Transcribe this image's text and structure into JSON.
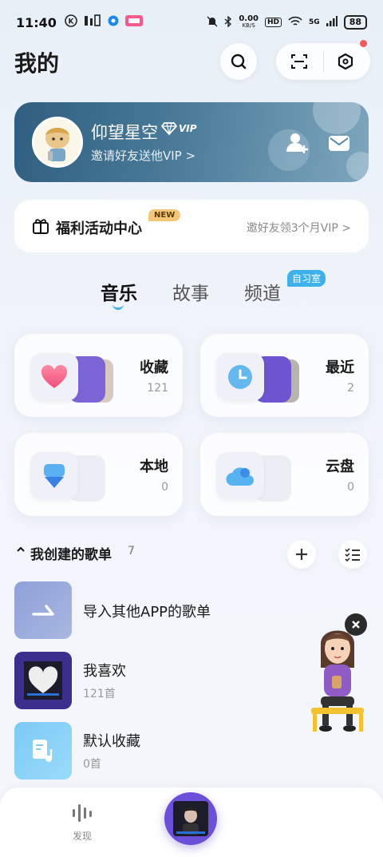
{
  "status_bar": {
    "time": "11:40",
    "net_speed_value": "0.00",
    "net_speed_unit": "KB/S",
    "hd": "HD",
    "signal": "5G",
    "battery": "88"
  },
  "header": {
    "title": "我的",
    "search_icon": "search-icon",
    "scan_icon": "scan-icon",
    "settings_icon": "settings-hexagon-icon"
  },
  "profile": {
    "username": "仰望星空",
    "vip_label": "VIP",
    "invite_text": "邀请好友送他VIP >",
    "colors": {
      "card_start": "#2f5e80",
      "card_end": "#7ea6be"
    }
  },
  "welfare": {
    "title": "福利活动中心",
    "new_tag": "NEW",
    "right_text": "邀好友领3个月VIP >"
  },
  "tabs": [
    {
      "label": "音乐",
      "active": true
    },
    {
      "label": "故事",
      "active": false
    },
    {
      "label": "频道",
      "active": false,
      "tag": "自习室"
    }
  ],
  "cards": [
    {
      "label": "收藏",
      "count": "121",
      "icon": "heart-icon"
    },
    {
      "label": "最近",
      "count": "2",
      "icon": "clock-icon"
    },
    {
      "label": "本地",
      "count": "0",
      "icon": "local-icon"
    },
    {
      "label": "云盘",
      "count": "0",
      "icon": "cloud-icon"
    }
  ],
  "section": {
    "title": "我创建的歌单",
    "count": "7"
  },
  "playlists": [
    {
      "name": "导入其他APP的歌单",
      "sub": ""
    },
    {
      "name": "我喜欢",
      "sub": "121首"
    },
    {
      "name": "默认收藏",
      "sub": "0首"
    }
  ],
  "bottom_nav": {
    "discover_label": "发现"
  },
  "accent": "#47b3e8"
}
